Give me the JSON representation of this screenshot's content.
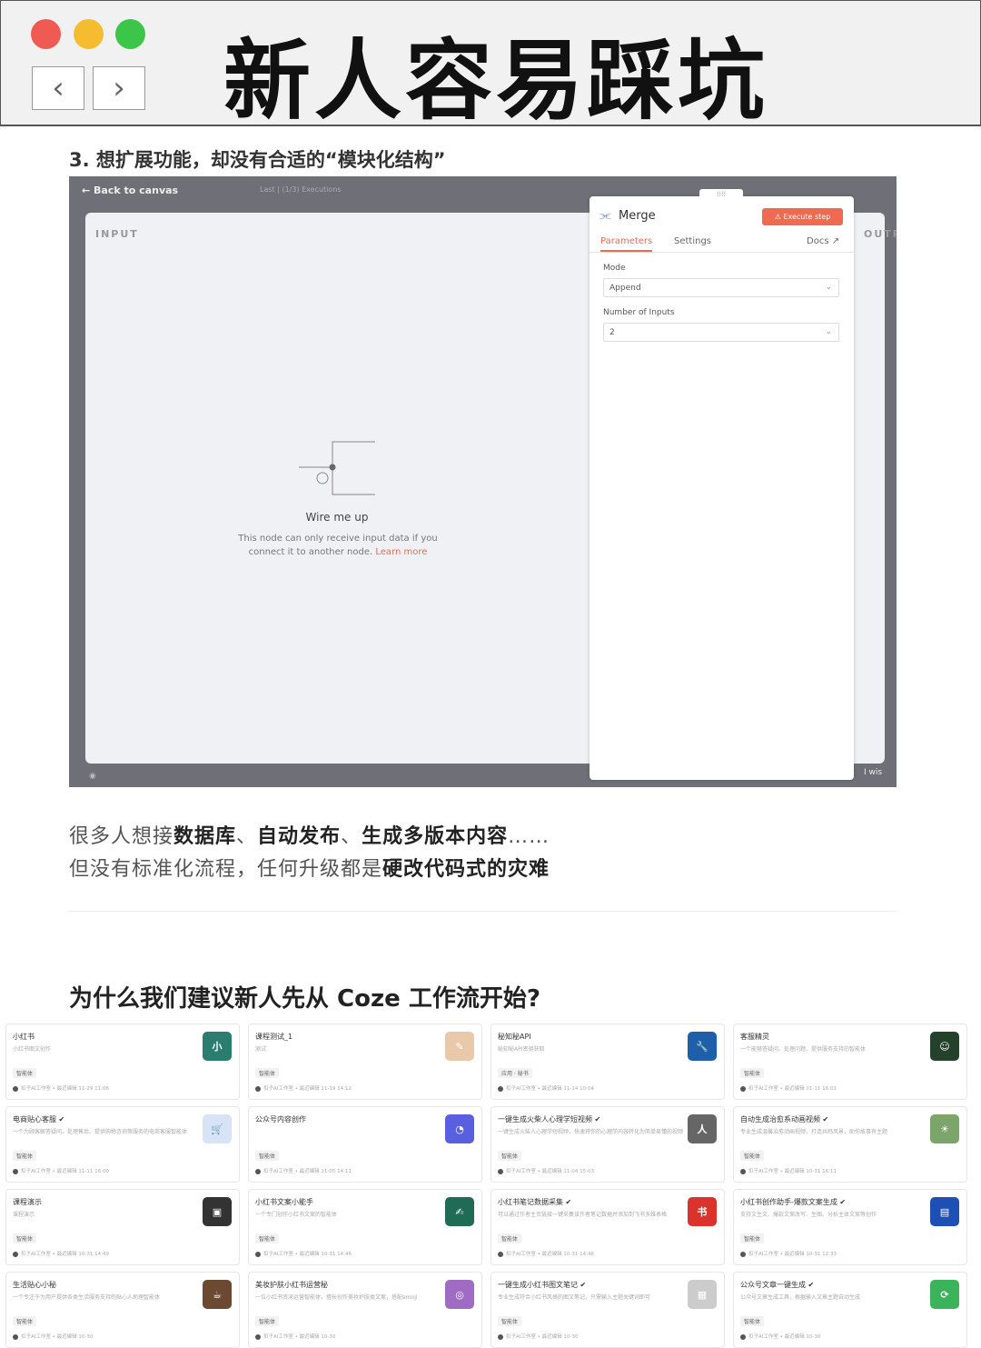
{
  "window": {
    "title": "新人容易踩坑",
    "back_glyph": "‹",
    "forward_glyph": "›"
  },
  "section3_heading": "3. 想扩展功能，却没有合适的“模块化结构”",
  "screenshot": {
    "back_to_canvas": "← Back to canvas",
    "toolbar_hint": "Last | (1/3) Executions",
    "input_label": "INPUT",
    "output_label": "OUTP",
    "wire_title": "Wire me up",
    "wire_desc": "This node can only receive input data if you connect it to another node.",
    "learn_more": "Learn more",
    "bottom_hint": "I wis",
    "panel": {
      "grip": "⁞⁞⁞⁞",
      "title": "Merge",
      "execute_label": "⚠ Execute step",
      "tabs": [
        "Parameters",
        "Settings",
        "Docs ↗"
      ],
      "mode_label": "Mode",
      "mode_value": "Append",
      "inputs_label": "Number of Inputs",
      "inputs_value": "2"
    }
  },
  "paragraph": {
    "line1_a": "很多人想接",
    "line1_b": "数据库",
    "line1_c": "、",
    "line1_d": "自动发布",
    "line1_e": "、",
    "line1_f": "生成多版本内容",
    "line1_g": "……",
    "line2_a": "但没有标准化流程，任何升级都是",
    "line2_b": "硬改代码式的灾难"
  },
  "section_heading": "为什么我们建议新人先从 Coze 工作流开始?",
  "cards": [
    {
      "title": "小红书",
      "desc": "小红书图文创作",
      "tag": "智能体",
      "footer": "扣子AI工作室 • 最近编辑 11-29 11:06",
      "icon": "小",
      "color": "#2a7d6f"
    },
    {
      "title": "课程测试_1",
      "desc": "测试",
      "tag": "智能体",
      "footer": "扣子AI工作室 • 最近编辑 11-19 14:12",
      "icon": "✎",
      "color": "#e9c9a9"
    },
    {
      "title": "秘知秘API",
      "desc": "秘知秘API密钥获取",
      "tag": "应用 · 秘书",
      "footer": "扣子AI工作室 • 最近编辑 11-14 10:04",
      "icon": "🔧",
      "color": "#1d5fa8"
    },
    {
      "title": "客服精灵",
      "desc": "一个能够答疑问、处理问题、提供服务支持的智能体",
      "tag": "智能体",
      "footer": "扣子AI工作室 • 最近编辑 11-11 16:01",
      "icon": "☺",
      "color": "#24412c"
    },
    {
      "title": "电商贴心客服 ✔",
      "desc": "一个为顾客解答疑问、处理售后、提供购物咨询等服务的电商客服智能体",
      "tag": "智能体",
      "footer": "扣子AI工作室 • 最近编辑 11-11 16:00",
      "icon": "🛒",
      "color": "#d7e3f7"
    },
    {
      "title": "公众号内容创作",
      "desc": "",
      "tag": "智能体",
      "footer": "扣子AI工作室 • 最近编辑 11-05 14:11",
      "icon": "◔",
      "color": "#5a5fe0"
    },
    {
      "title": "一键生成火柴人心理学短视频 ✔",
      "desc": "一键生成火柴人心理学短视频，快速将你的心理学内容转化为简单易懂的视频",
      "tag": "智能体",
      "footer": "扣子AI工作室 • 最近编辑 11-04 15:03",
      "icon": "人",
      "color": "#666"
    },
    {
      "title": "自动生成治愈系动画视频 ✔",
      "desc": "专业生成温馨治愈动画视频，打造共鸣风景，助你故事有主题",
      "tag": "智能体",
      "footer": "扣子AI工作室 • 最近编辑 10-31 16:11",
      "icon": "☀",
      "color": "#7ca56b"
    },
    {
      "title": "课程演示",
      "desc": "课程演示",
      "tag": "智能体",
      "footer": "扣子AI工作室 • 最近编辑 10-31 14:49",
      "icon": "▣",
      "color": "#333"
    },
    {
      "title": "小红书文案小能手",
      "desc": "一个专门创作小红书文案的智能体",
      "tag": "智能体",
      "footer": "扣子AI工作室 • 最近编辑 10-31 14:46",
      "icon": "✍",
      "color": "#1f6b54"
    },
    {
      "title": "小红书笔记数据采集 ✔",
      "desc": "可以通过作者主页链接一键采集该作者笔记数据并添加到飞书多维表格",
      "tag": "智能体",
      "footer": "扣子AI工作室 • 最近编辑 10-31 14:46",
      "icon": "书",
      "color": "#d9332b"
    },
    {
      "title": "小红书创作助手-爆款文案生成 ✔",
      "desc": "支持文生文、爆款文案改写、生图、分析主体文案等创作",
      "tag": "智能体",
      "footer": "扣子AI工作室 • 最近编辑 10-31 12:33",
      "icon": "▤",
      "color": "#1e4fb5"
    },
    {
      "title": "生活贴心小秘",
      "desc": "一个专注于为用户提供各类生活服务支持的贴心人助理智能体",
      "tag": "智能体",
      "footer": "扣子AI工作室 • 最近编辑 10-30",
      "icon": "☕",
      "color": "#6b4a31"
    },
    {
      "title": "美妆护肤小红书运营秘",
      "desc": "一位小红书资深运营智能体，擅长创作美妆护肤类文案，搭配emoji",
      "tag": "智能体",
      "footer": "扣子AI工作室 • 最近编辑 10-30",
      "icon": "◎",
      "color": "#a06bc2"
    },
    {
      "title": "一键生成小红书图文笔记 ✔",
      "desc": "专业生成符合小红书风格的图文笔记，只需输入主题关键词即可",
      "tag": "智能体",
      "footer": "扣子AI工作室 • 最近编辑 10-30",
      "icon": "▦",
      "color": "#ccc"
    },
    {
      "title": "公众号文章一键生成 ✔",
      "desc": "公众号文章生成工具，根据输入文章主题自动生成",
      "tag": "智能体",
      "footer": "扣子AI工作室 • 最近编辑 10-30",
      "icon": "⟳",
      "color": "#3ab35a"
    }
  ]
}
